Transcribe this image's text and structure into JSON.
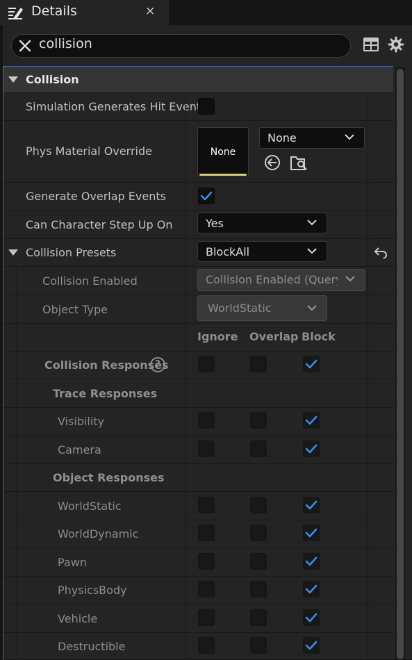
{
  "tab": {
    "title": "Details",
    "close": "×"
  },
  "search": {
    "value": "collision"
  },
  "toolbar": {
    "icons": [
      "grid-table-icon",
      "settings-gear-icon"
    ]
  },
  "category": {
    "label": "Collision"
  },
  "properties": {
    "sim_hit_events": {
      "label": "Simulation Generates Hit Events",
      "checked": false
    },
    "phys_material": {
      "label": "Phys Material Override",
      "thumb": "None",
      "value": "None"
    },
    "overlap_events": {
      "label": "Generate Overlap Events",
      "checked": true
    },
    "step_up": {
      "label": "Can Character Step Up On",
      "value": "Yes"
    },
    "presets": {
      "label": "Collision Presets",
      "value": "BlockAll"
    },
    "collision_enabled": {
      "label": "Collision Enabled",
      "value": "Collision Enabled (Query ar"
    },
    "object_type": {
      "label": "Object Type",
      "value": "WorldStatic"
    }
  },
  "response_columns": [
    "Ignore",
    "Overlap",
    "Block"
  ],
  "collision_responses": {
    "label": "Collision Responses",
    "help": "?"
  },
  "trace_responses": {
    "label": "Trace Responses",
    "items": [
      {
        "label": "Visibility",
        "response": "Block"
      },
      {
        "label": "Camera",
        "response": "Block"
      }
    ]
  },
  "object_responses": {
    "label": "Object Responses",
    "items": [
      {
        "label": "WorldStatic",
        "response": "Block"
      },
      {
        "label": "WorldDynamic",
        "response": "Block"
      },
      {
        "label": "Pawn",
        "response": "Block"
      },
      {
        "label": "PhysicsBody",
        "response": "Block"
      },
      {
        "label": "Vehicle",
        "response": "Block"
      },
      {
        "label": "Destructible",
        "response": "Block"
      }
    ]
  },
  "colors": {
    "accent": "#2b6ed8",
    "check": "#3a8de8",
    "material_bar": "#d9cc78"
  }
}
